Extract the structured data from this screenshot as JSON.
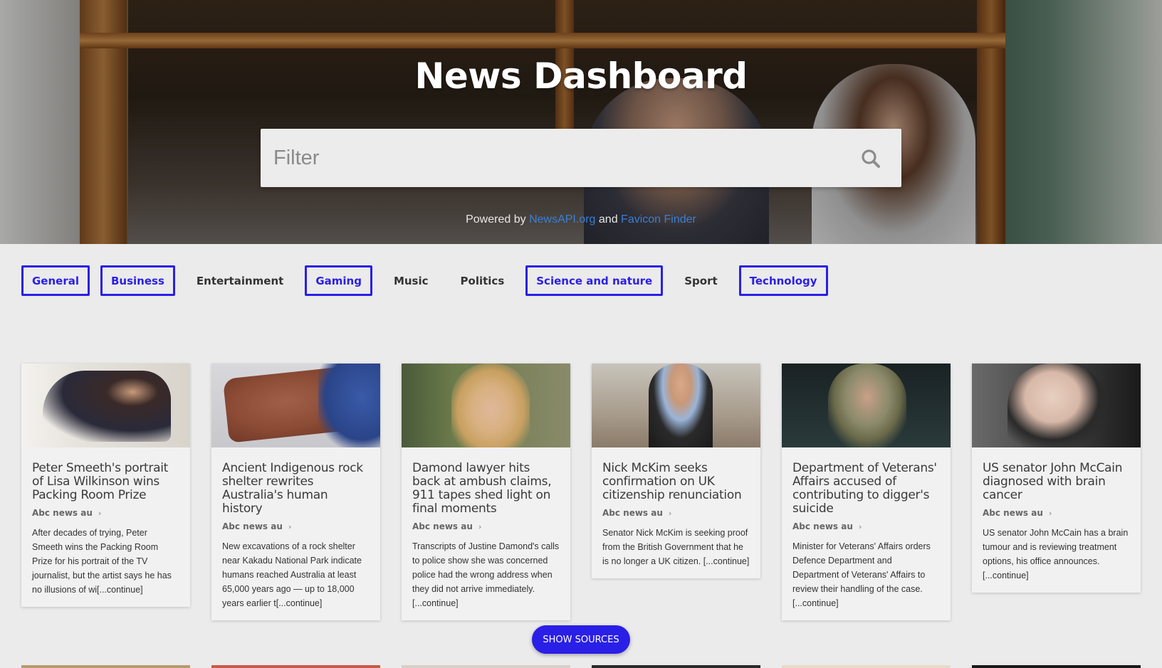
{
  "hero": {
    "title": "News Dashboard",
    "search_placeholder": "Filter",
    "powered_prefix": "Powered by",
    "powered_link1": "NewsAPI.org",
    "powered_and": "and",
    "powered_link2": "Favicon Finder"
  },
  "categories": [
    {
      "label": "General",
      "active": true
    },
    {
      "label": "Business",
      "active": true
    },
    {
      "label": "Entertainment",
      "active": false
    },
    {
      "label": "Gaming",
      "active": true
    },
    {
      "label": "Music",
      "active": false
    },
    {
      "label": "Politics",
      "active": false
    },
    {
      "label": "Science and nature",
      "active": true
    },
    {
      "label": "Sport",
      "active": false
    },
    {
      "label": "Technology",
      "active": true
    }
  ],
  "cards": [
    {
      "title": "Peter Smeeth's portrait of Lisa Wilkinson wins Packing Room Prize",
      "source": "Abc news au",
      "description": "After decades of trying, Peter Smeeth wins the Packing Room Prize for his portrait of the TV journalist, but the artist says he has no illusions of wi[...continue]"
    },
    {
      "title": "Ancient Indigenous rock shelter rewrites Australia's human history",
      "source": "Abc news au",
      "description": "New excavations of a rock shelter near Kakadu National Park indicate humans reached Australia at least 65,000 years ago — up to 18,000 years earlier t[...continue]"
    },
    {
      "title": "Damond lawyer hits back at ambush claims, 911 tapes shed light on final moments",
      "source": "Abc news au",
      "description": "Transcripts of Justine Damond's calls to police show she was concerned police had the wrong address when they did not arrive immediately.[...continue]"
    },
    {
      "title": "Nick McKim seeks confirmation on UK citizenship renunciation",
      "source": "Abc news au",
      "description": "Senator Nick McKim is seeking proof from the British Government that he is no longer a UK citizen. [...continue]"
    },
    {
      "title": "Department of Veterans' Affairs accused of contributing to digger's suicide",
      "source": "Abc news au",
      "description": "Minister for Veterans' Affairs orders Defence Department and Department of Veterans' Affairs to review their handling of the case. [...continue]"
    },
    {
      "title": "US senator John McCain diagnosed with brain cancer",
      "source": "Abc news au",
      "description": "US senator John McCain has a brain tumour and is reviewing treatment options, his office announces. [...continue]"
    }
  ],
  "show_sources_label": "SHOW SOURCES",
  "colors": {
    "accent": "#2a1fe6",
    "link": "#3a7fd4",
    "page_bg": "#ebebeb",
    "card_bg": "#f1f1f1"
  }
}
